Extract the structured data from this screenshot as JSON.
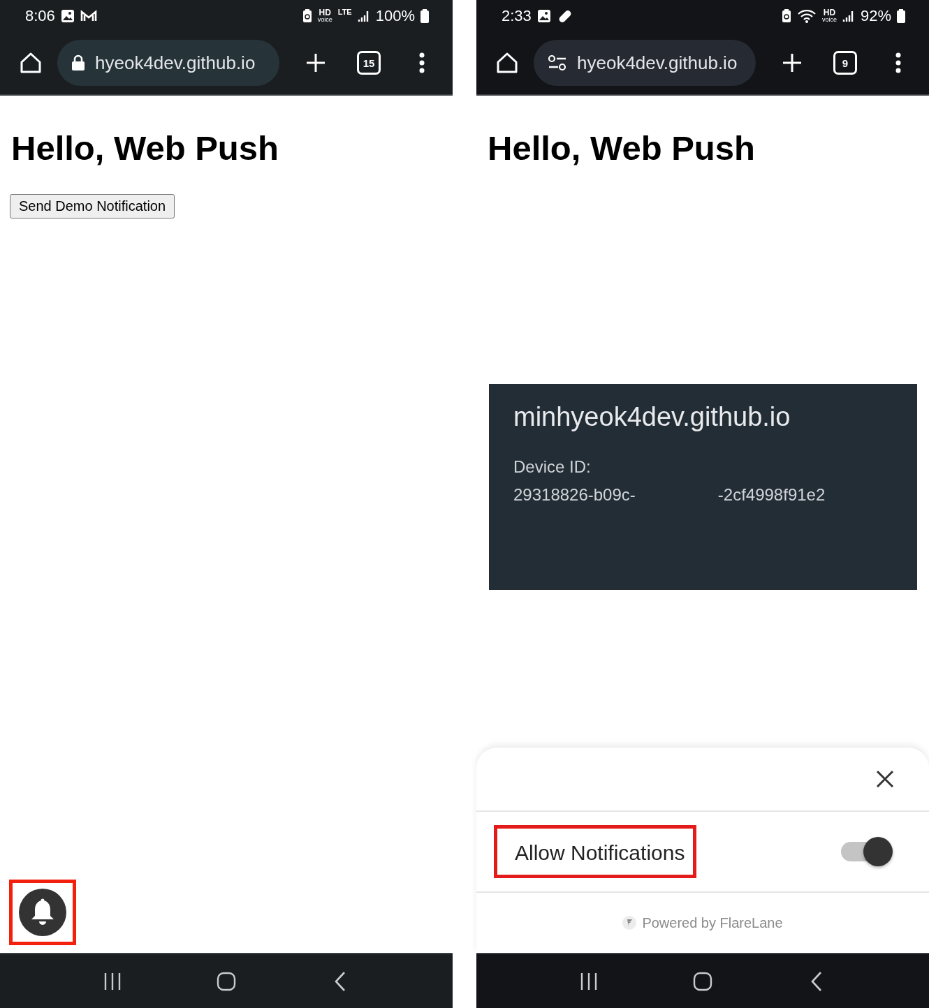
{
  "phones": [
    {
      "status_bar": {
        "time": "8:06",
        "hd": "HD",
        "hd_sub": "voice",
        "network": "LTE",
        "wifi": false,
        "battery": "100%"
      },
      "toolbar": {
        "url": "hyeok4dev.github.io",
        "tab_count": "15"
      },
      "page": {
        "heading": "Hello, Web Push",
        "button": "Send Demo Notification",
        "bell": {
          "highlighted": true
        }
      }
    },
    {
      "status_bar": {
        "time": "2:33",
        "hd": "HD",
        "hd_sub": "voice",
        "wifi": true,
        "battery": "92%"
      },
      "toolbar": {
        "url": "hyeok4dev.github.io",
        "tab_count": "9"
      },
      "page": {
        "heading": "Hello, Web Push",
        "notification": {
          "title": "minhyeok4dev.github.io",
          "label": "Device ID:",
          "id_start": "29318826-b09c-",
          "id_end": "-2cf4998f91e2"
        },
        "sheet": {
          "option": {
            "label": "Allow Notifications",
            "checked": true,
            "highlighted": true
          },
          "footer": "Powered by FlareLane"
        }
      }
    }
  ]
}
